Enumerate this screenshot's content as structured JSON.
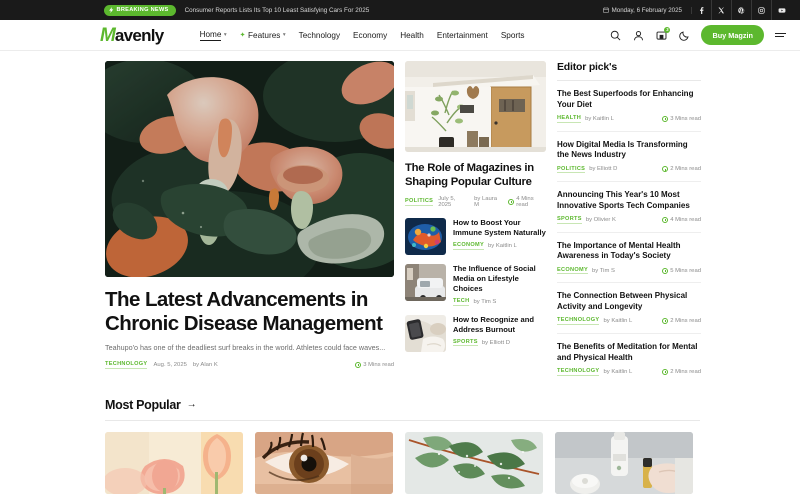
{
  "topbar": {
    "breaking_label": "BREAKING NEWS",
    "breaking_icon": "bolt-icon",
    "headline": "Consumer Reports Lists Its Top 10 Least Satisfying Cars For 2025",
    "date": "Monday, 6 February 2025",
    "socials": [
      "facebook-icon",
      "x-icon",
      "pinterest-icon",
      "instagram-icon",
      "youtube-icon"
    ]
  },
  "nav": {
    "logo_mark": "M",
    "logo_text": "avenly",
    "links": [
      {
        "label": "Home",
        "has_caret": true,
        "has_spark": false,
        "active": true
      },
      {
        "label": "Features",
        "has_caret": true,
        "has_spark": true,
        "active": false
      },
      {
        "label": "Technology",
        "has_caret": false,
        "has_spark": false,
        "active": false
      },
      {
        "label": "Economy",
        "has_caret": false,
        "has_spark": false,
        "active": false
      },
      {
        "label": "Health",
        "has_caret": false,
        "has_spark": false,
        "active": false
      },
      {
        "label": "Entertainment",
        "has_caret": false,
        "has_spark": false,
        "active": false
      },
      {
        "label": "Sports",
        "has_caret": false,
        "has_spark": false,
        "active": false
      }
    ],
    "cart_badge": "3",
    "buy_label": "Buy Magzin"
  },
  "hero": {
    "title": "The Latest Advancements in Chronic Disease Management",
    "excerpt": "Teahupo'o has one of the deadliest surf breaks in the world. Athletes could face waves...",
    "category": "TECHNOLOGY",
    "date": "Aug. 5, 2025",
    "author": "by Alan K",
    "read_time": "3 Mins read",
    "image_alt": "pink-calla-lily-flowers"
  },
  "mid": {
    "feature": {
      "title": "The Role of Magazines in Shaping Popular Culture",
      "category": "POLITICS",
      "date": "July 5, 2025",
      "author": "by Laura M",
      "read_time": "4 Mins read",
      "image_alt": "white-house-wooden-door"
    },
    "items": [
      {
        "title": "How to Boost Your Immune System Naturally",
        "category": "ECONOMY",
        "author": "by Kaitlin L",
        "image_alt": "colorful-abstract-art"
      },
      {
        "title": "The Influence of Social Media on Lifestyle Choices",
        "category": "TECH",
        "author": "by Tim S",
        "image_alt": "autonomous-delivery-van"
      },
      {
        "title": "How to Recognize and Address Burnout",
        "category": "SPORTS",
        "author": "by Elliott D",
        "image_alt": "phone-on-white-blanket"
      }
    ]
  },
  "sidebar": {
    "heading": "Editor pick's",
    "items": [
      {
        "title": "The Best Superfoods for Enhancing Your Diet",
        "category": "HEALTH",
        "author": "by Kaitlin L",
        "read_time": "3 Mins read"
      },
      {
        "title": "How Digital Media Is Transforming the News Industry",
        "category": "POLITICS",
        "author": "by Elliott D",
        "read_time": "2 Mins read"
      },
      {
        "title": "Announcing This Year's 10 Most Innovative Sports Tech Companies",
        "category": "SPORTS",
        "author": "by Olivier K",
        "read_time": "4 Mins read"
      },
      {
        "title": "The Importance of Mental Health Awareness in Today's Society",
        "category": "ECONOMY",
        "author": "by Tim S",
        "read_time": "5 Mins read"
      },
      {
        "title": "The Connection Between Physical Activity and Longevity",
        "category": "TECHNOLOGY",
        "author": "by Kaitlin L",
        "read_time": "2 Mins read"
      },
      {
        "title": "The Benefits of Meditation for Mental and Physical Health",
        "category": "TECHNOLOGY",
        "author": "by Kaitlin L",
        "read_time": "2 Mins read"
      }
    ]
  },
  "most_popular": {
    "heading": "Most Popular",
    "arrow": "→",
    "cards": [
      {
        "image_alt": "pink-tulips-close-up"
      },
      {
        "image_alt": "brown-human-eye-close-up"
      },
      {
        "image_alt": "green-leaves-branch"
      },
      {
        "image_alt": "skincare-products-hand"
      }
    ]
  },
  "colors": {
    "accent": "#5cb82e",
    "topbar_bg": "#1a1a1a",
    "text": "#111111",
    "muted": "#8b8b8b"
  }
}
